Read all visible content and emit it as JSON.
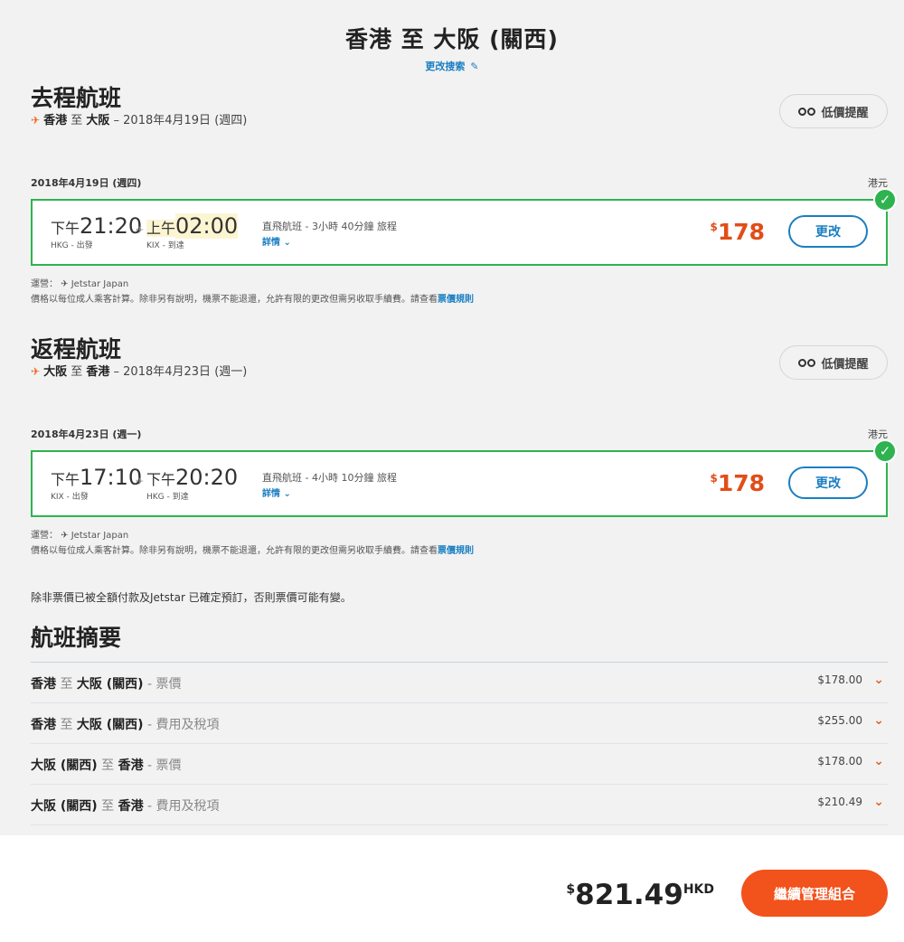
{
  "header": {
    "title": "香港 至 大阪 (關西)",
    "modify_label": "更改搜索"
  },
  "outbound": {
    "heading": "去程航班",
    "route_from": "香港",
    "route_to_word": "至",
    "route_to": "大阪",
    "route_date": "– 2018年4月19日 (週四)",
    "alert_label": "低價提醒",
    "date_label": "2018年4月19日 (週四)",
    "currency": "港元",
    "dep_period": "下午",
    "dep_time": "21:20",
    "dep_airport": "HKG - 出發",
    "arr_period": "上午",
    "arr_time": "02:00",
    "arr_airport": "KIX - 到達",
    "flight_info": "直飛航班 - 3小時 40分鐘 旅程",
    "details_label": "詳情",
    "price_symbol": "$",
    "price": "178",
    "change_label": "更改",
    "operator": "運營： ✈ Jetstar Japan",
    "fare_note": "價格以每位成人乘客計算。除非另有說明，機票不能退還，允許有限的更改但需另收取手續費。請查看",
    "fare_rules_link": "票價規則"
  },
  "return": {
    "heading": "返程航班",
    "route_from": "大阪",
    "route_to_word": "至",
    "route_to": "香港",
    "route_date": "– 2018年4月23日 (週一)",
    "alert_label": "低價提醒",
    "date_label": "2018年4月23日 (週一)",
    "currency": "港元",
    "dep_period": "下午",
    "dep_time": "17:10",
    "dep_airport": "KIX - 出發",
    "arr_period": "下午",
    "arr_time": "20:20",
    "arr_airport": "HKG - 到達",
    "flight_info": "直飛航班 - 4小時 10分鐘 旅程",
    "details_label": "詳情",
    "price_symbol": "$",
    "price": "178",
    "change_label": "更改",
    "operator": "運營： ✈ Jetstar Japan",
    "fare_note": "價格以每位成人乘客計算。除非另有說明，機票不能退還，允許有限的更改但需另收取手續費。請查看",
    "fare_rules_link": "票價規則"
  },
  "notice": "除非票價已被全額付款及Jetstar 已確定預訂，否則票價可能有變。",
  "summary": {
    "title": "航班摘要",
    "rows": [
      {
        "from": "香港",
        "to_word": "至",
        "to": "大阪 (關西)",
        "kind": "- 票價",
        "amount": "$178.00"
      },
      {
        "from": "香港",
        "to_word": "至",
        "to": "大阪 (關西)",
        "kind": "- 費用及稅項",
        "amount": "$255.00"
      },
      {
        "from": "大阪 (關西)",
        "to_word": "至",
        "to": "香港",
        "kind": "- 票價",
        "amount": "$178.00"
      },
      {
        "from": "大阪 (關西)",
        "to_word": "至",
        "to": "香港",
        "kind": "- 費用及稅項",
        "amount": "$210.49"
      }
    ]
  },
  "footer": {
    "total_symbol": "$",
    "total": "821.49",
    "total_currency": "HKD",
    "cta_label": "繼續管理組合"
  },
  "icons": {
    "plane": "plane-icon",
    "binoculars": "binoculars-icon",
    "check": "check-icon",
    "chevron": "chevron-down-icon",
    "pencil": "pencil-icon"
  },
  "colors": {
    "accent_orange": "#f2521c",
    "price_orange": "#e24d17",
    "link_blue": "#1a7ec2",
    "selected_green": "#2eb34f"
  }
}
